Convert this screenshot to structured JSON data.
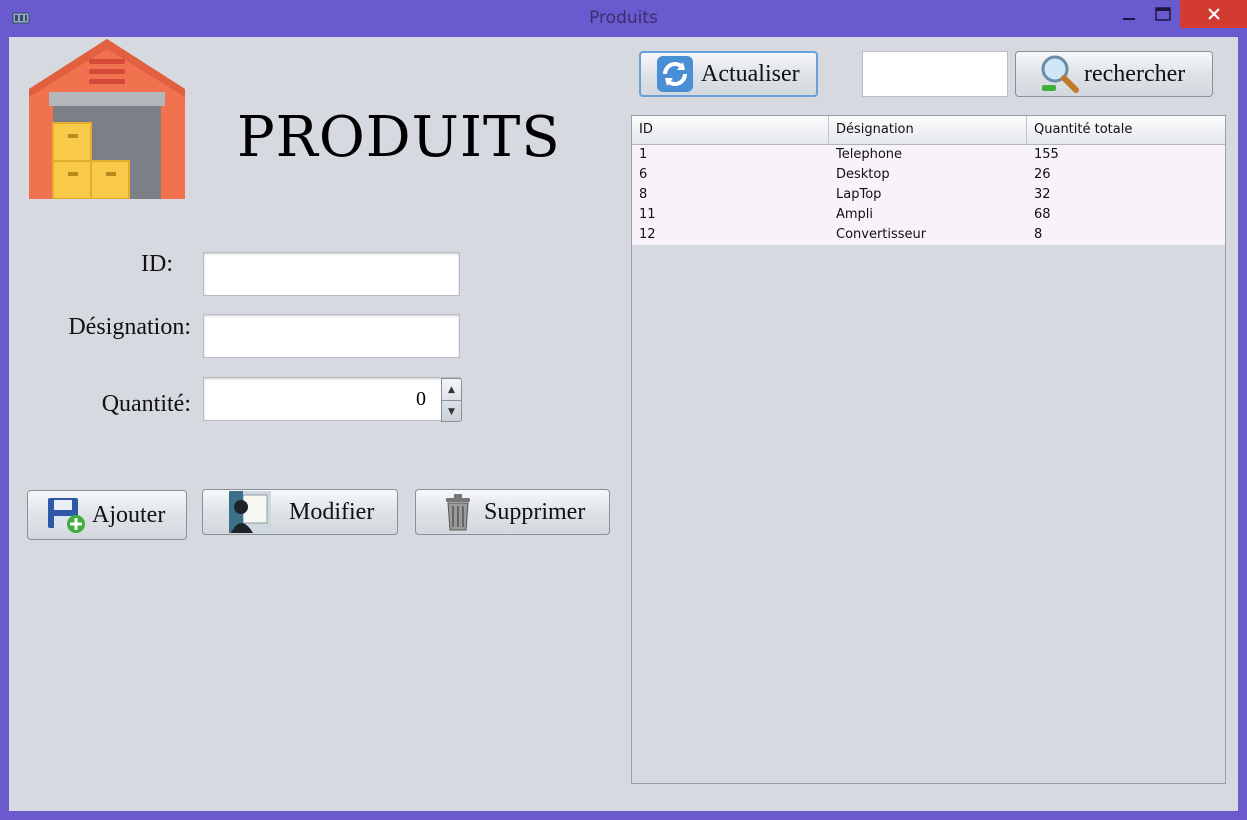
{
  "window": {
    "title": "Produits"
  },
  "page": {
    "heading": "PRODUITS"
  },
  "form": {
    "id_label": "ID:",
    "id_value": "",
    "designation_label": "Désignation:",
    "designation_value": "",
    "quantite_label": "Quantité:",
    "quantite_value": "0"
  },
  "actions": {
    "ajouter": "Ajouter",
    "modifier": "Modifier",
    "supprimer": "Supprimer"
  },
  "toolbar": {
    "actualiser": "Actualiser",
    "search_value": "",
    "rechercher": "rechercher"
  },
  "table": {
    "columns": [
      "ID",
      "Désignation",
      "Quantité totale"
    ],
    "rows": [
      [
        "1",
        "Telephone",
        "155"
      ],
      [
        "6",
        "Desktop",
        "26"
      ],
      [
        "8",
        "LapTop",
        "32"
      ],
      [
        "11",
        "Ampli",
        "68"
      ],
      [
        "12",
        "Convertisseur",
        "8"
      ]
    ]
  },
  "colors": {
    "titlebar": "#6a5ad0",
    "close": "#d43b30",
    "panel": "#d6d9e0",
    "row": "#f8f3fa"
  },
  "icons": [
    "app-icon",
    "warehouse-icon",
    "refresh-icon",
    "magnifier-icon",
    "save-add-icon",
    "person-document-icon",
    "trash-icon",
    "minimize-icon",
    "maximize-icon",
    "close-icon"
  ]
}
